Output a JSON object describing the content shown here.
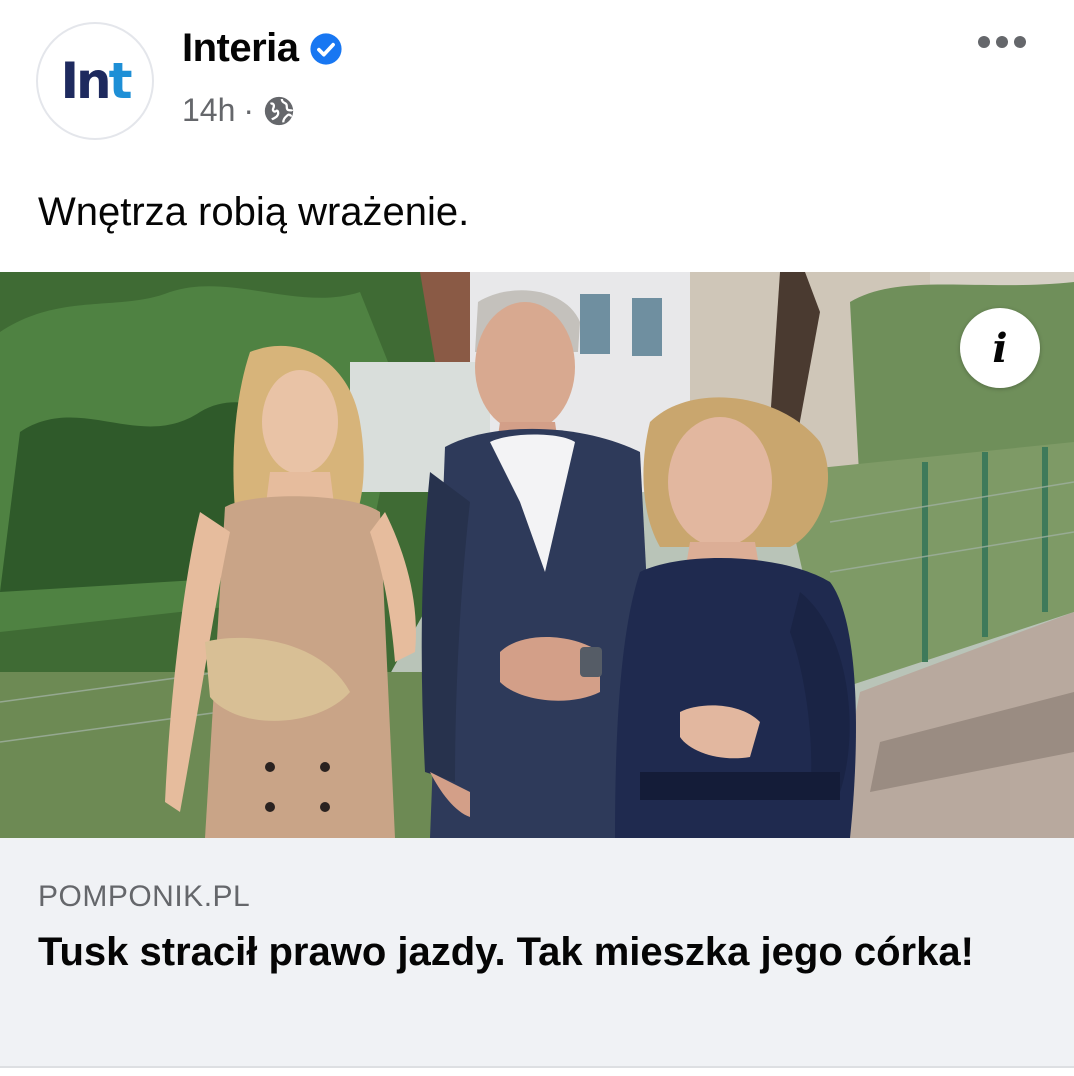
{
  "post": {
    "avatar_text_main": "In",
    "avatar_text_accent": "t",
    "page_name": "Interia",
    "timestamp": "14h",
    "separator": "·",
    "text": "Wnętrza robią wrażenie."
  },
  "link_preview": {
    "domain": "POMPONIK.PL",
    "title": "Tusk stracił prawo jazdy. Tak mieszka jego córka!",
    "info_label": "i"
  },
  "colors": {
    "verified_badge": "#1877f2",
    "meta_gray": "#65676b",
    "link_box_bg": "#f0f2f5"
  },
  "icons": {
    "verified": "verified-badge-icon",
    "audience": "globe-icon",
    "more": "more-options-icon",
    "info": "info-icon"
  }
}
